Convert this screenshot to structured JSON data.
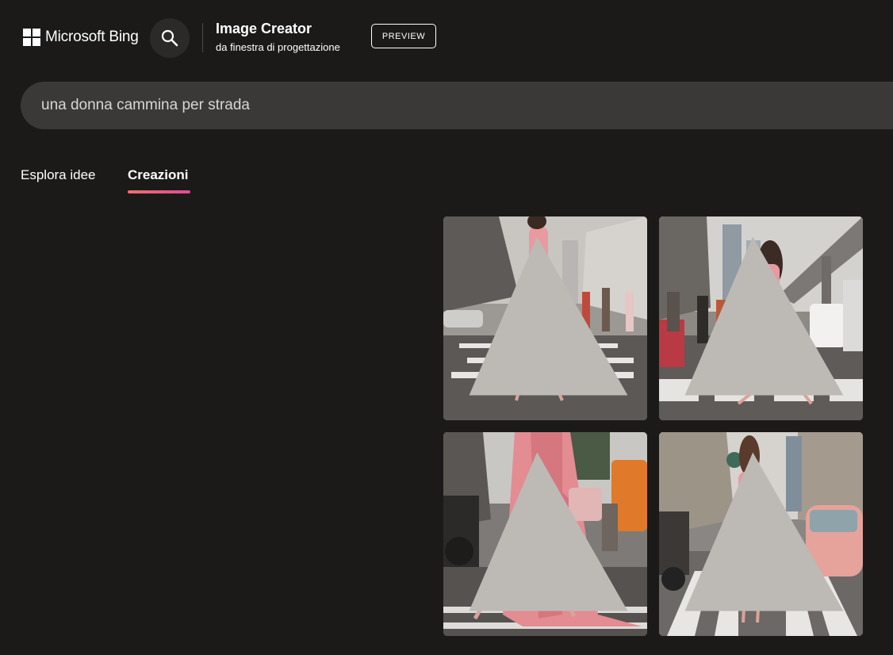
{
  "header": {
    "brand": "Microsoft Bing",
    "app_title": "Image Creator",
    "app_subtitle": "da finestra di progettazione",
    "badge": "PREVIEW"
  },
  "prompt": {
    "value": "una donna cammina per strada"
  },
  "tabs": [
    {
      "label": "Esplora idee",
      "active": false
    },
    {
      "label": "Creazioni",
      "active": true
    }
  ],
  "colors": {
    "background": "#1b1a19",
    "search_bar": "#3a3938",
    "tab_accent_start": "#f0706a",
    "tab_accent_end": "#e04a9a",
    "dress_pink": "#e58f94"
  },
  "icons": {
    "logo": "windows-logo-icon",
    "search": "search-icon",
    "tile_mark": "watermark-icon"
  },
  "images": [
    {
      "kind": "generated-image"
    },
    {
      "kind": "generated-image"
    },
    {
      "kind": "generated-image"
    },
    {
      "kind": "generated-image"
    }
  ]
}
